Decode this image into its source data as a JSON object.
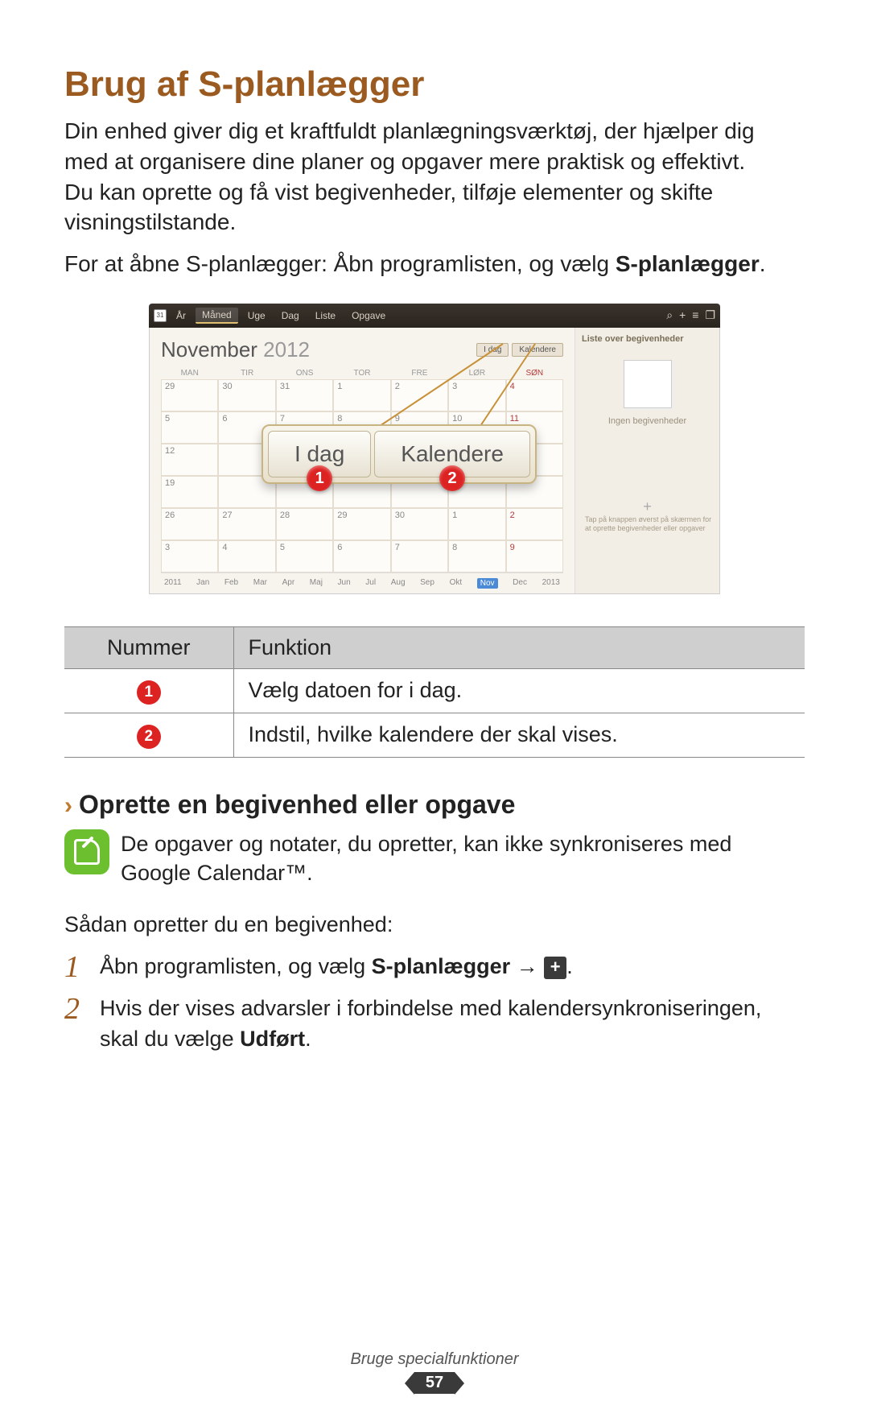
{
  "title": "Brug af S-planlægger",
  "intro1": "Din enhed giver dig et kraftfuldt planlægningsværktøj, der hjælper dig med at organisere dine planer og opgaver mere praktisk og effektivt. Du kan oprette og få vist begivenheder, tilføje elementer og skifte visningstilstande.",
  "intro2_a": "For at åbne S-planlægger: Åbn programlisten, og vælg ",
  "intro2_b": "S-planlægger",
  "intro2_c": ".",
  "screenshot": {
    "cal_icon": "31",
    "tabs": [
      "År",
      "Måned",
      "Uge",
      "Dag",
      "Liste",
      "Opgave"
    ],
    "month": "November",
    "year": "2012",
    "mini_btn1": "I dag",
    "mini_btn2": "Kalendere",
    "dow": [
      "MAN",
      "TIR",
      "ONS",
      "TOR",
      "FRE",
      "LØR",
      "SØN"
    ],
    "weeks": [
      [
        "29",
        "30",
        "31",
        "1",
        "2",
        "3",
        "4"
      ],
      [
        "5",
        "6",
        "7",
        "8",
        "9",
        "10",
        "11"
      ],
      [
        "12",
        "",
        "",
        "",
        "",
        "",
        ""
      ],
      [
        "19",
        "",
        "",
        "",
        "",
        "",
        ""
      ],
      [
        "26",
        "27",
        "28",
        "29",
        "30",
        "1",
        "2"
      ],
      [
        "3",
        "4",
        "5",
        "6",
        "7",
        "8",
        "9"
      ]
    ],
    "side_head": "Liste over begivenheder",
    "side_none": "Ingen begivenheder",
    "side_tip": "Tap på knappen øverst på skærmen for at oprette begivenheder eller opgaver",
    "months_bar": [
      "2011",
      "Jan",
      "Feb",
      "Mar",
      "Apr",
      "Maj",
      "Jun",
      "Jul",
      "Aug",
      "Sep",
      "Okt",
      "Nov",
      "Dec",
      "2013"
    ],
    "months_sel": "Nov",
    "callout_btn1": "I dag",
    "callout_btn2": "Kalendere",
    "callout_num1": "1",
    "callout_num2": "2"
  },
  "table": {
    "h1": "Nummer",
    "h2": "Funktion",
    "r1_num": "1",
    "r1_txt": "Vælg datoen for i dag.",
    "r2_num": "2",
    "r2_txt": "Indstil, hvilke kalendere der skal vises."
  },
  "sub_heading": "Oprette en begivenhed eller opgave",
  "note": "De opgaver og notater, du opretter, kan ikke synkroniseres med Google Calendar™.",
  "lead": "Sådan opretter du en begivenhed:",
  "step1_a": "Åbn programlisten, og vælg ",
  "step1_b": "S-planlægger",
  "step1_c": " → ",
  "step1_d": ".",
  "step2_a": "Hvis der vises advarsler i forbindelse med kalendersynkroniseringen, skal du vælge ",
  "step2_b": "Udført",
  "step2_c": ".",
  "footer_section": "Bruge specialfunktioner",
  "page_num": "57"
}
